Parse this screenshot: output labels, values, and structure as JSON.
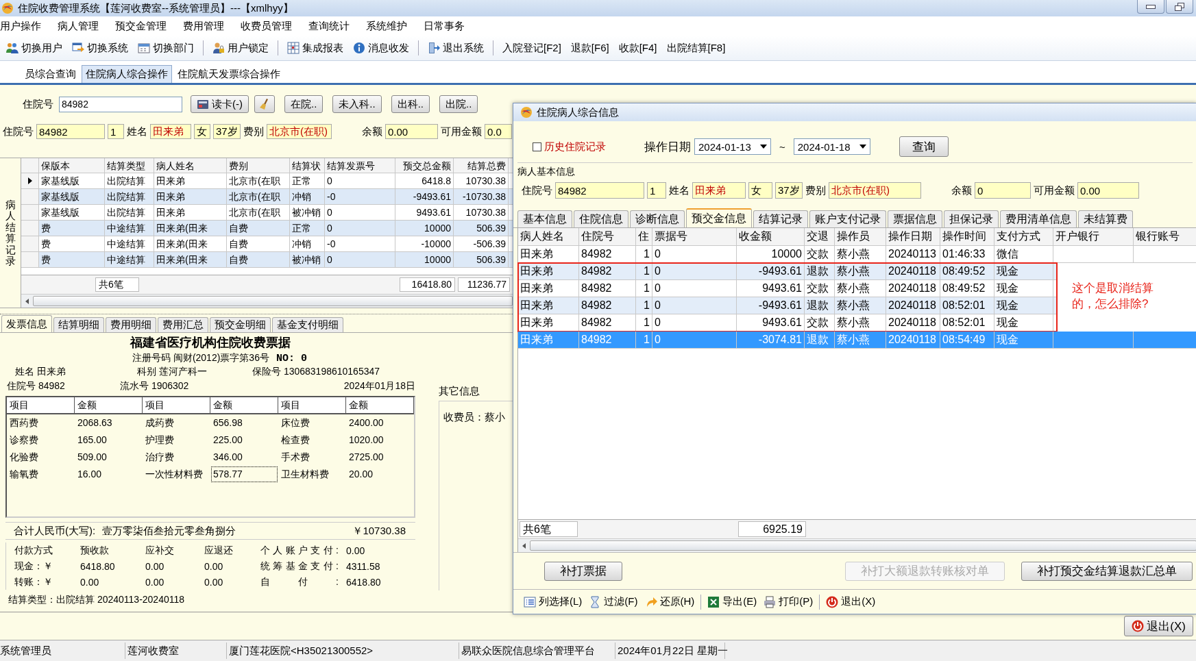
{
  "window": {
    "title": "住院收费管理系统【莲河收费室--系统管理员】---【xmlhyy】"
  },
  "menu": [
    "用户操作",
    "病人管理",
    "预交金管理",
    "费用管理",
    "收费员管理",
    "查询统计",
    "系统维护",
    "日常事务"
  ],
  "toolbar": {
    "groups": [
      [
        {
          "label": "切换用户"
        },
        {
          "label": "切换系统"
        },
        {
          "label": "切换部门"
        }
      ],
      [
        {
          "label": "用户锁定"
        }
      ],
      [
        {
          "label": "集成报表"
        },
        {
          "label": "消息收发"
        }
      ],
      [
        {
          "label": "退出系统"
        }
      ],
      [
        {
          "label": "入院登记[F2]"
        },
        {
          "label": "退款[F6]"
        },
        {
          "label": "收款[F4]"
        },
        {
          "label": "出院结算[F8]"
        }
      ]
    ]
  },
  "top_tabs": [
    {
      "label": "员综合查询",
      "selected": false
    },
    {
      "label": "住院病人综合操作",
      "selected": true
    },
    {
      "label": "住院航天发票综合操作",
      "selected": false
    }
  ],
  "search": {
    "label": "住院号",
    "value": "84982",
    "buttons": [
      {
        "kind": "card",
        "label": "读卡(-)"
      },
      {
        "kind": "broom"
      },
      {
        "kind": "plain",
        "label": "在院.."
      },
      {
        "kind": "plain",
        "label": "未入科.."
      },
      {
        "kind": "plain",
        "label": "出科.."
      },
      {
        "kind": "plain",
        "label": "出院.."
      }
    ]
  },
  "patient_info": {
    "fields": [
      {
        "label": "住院号",
        "value": "84982",
        "alert": false
      },
      {
        "value": "1",
        "alert": false
      },
      {
        "label": "姓名",
        "value": "田来弟",
        "alert": true
      },
      {
        "value": "女",
        "alert": false
      },
      {
        "value": "37岁",
        "alert": false
      },
      {
        "label": "费别",
        "value": "北京市(在职)",
        "alert": true
      },
      {
        "label": "余额",
        "value": "0.00",
        "alert": false
      },
      {
        "label": "可用金额",
        "value": "0.0",
        "alert": false
      }
    ]
  },
  "settlements": {
    "side_label": "病人结算记录",
    "columns": [
      "保版本",
      "结算类型",
      "病人姓名",
      "费别",
      "结算状",
      "结算发票号",
      "预交总金额",
      "结算总费"
    ],
    "rows": [
      {
        "current": true,
        "cells": [
          "家基线版",
          "出院结算",
          "田来弟",
          "北京市(在职",
          "正常",
          "0",
          "6418.8",
          "10730.38"
        ]
      },
      {
        "current": false,
        "cells": [
          "家基线版",
          "出院结算",
          "田来弟",
          "北京市(在职",
          "冲销",
          "-0",
          "-9493.61",
          "-10730.38"
        ]
      },
      {
        "current": false,
        "cells": [
          "家基线版",
          "出院结算",
          "田来弟",
          "北京市(在职",
          "被冲销",
          "0",
          "9493.61",
          "10730.38"
        ]
      },
      {
        "current": false,
        "cells": [
          "费",
          "中途结算",
          "田来弟(田来",
          "自费",
          "正常",
          "0",
          "10000",
          "506.39"
        ]
      },
      {
        "current": false,
        "cells": [
          "费",
          "中途结算",
          "田来弟(田来",
          "自费",
          "冲销",
          "-0",
          "-10000",
          "-506.39"
        ]
      },
      {
        "current": false,
        "cells": [
          "费",
          "中途结算",
          "田来弟(田来",
          "自费",
          "被冲销",
          "0",
          "10000",
          "506.39"
        ]
      }
    ],
    "footer": {
      "count": "共6笔",
      "totals": [
        "16418.80",
        "11236.77"
      ]
    }
  },
  "receipt_tabs": [
    {
      "label": "发票信息",
      "selected": true
    },
    {
      "label": "结算明细",
      "selected": false
    },
    {
      "label": "费用明细",
      "selected": false
    },
    {
      "label": "费用汇总",
      "selected": false
    },
    {
      "label": "预交金明细",
      "selected": false
    },
    {
      "label": "基金支付明细",
      "selected": false
    }
  ],
  "receipt": {
    "title": "福建省医疗机构住院收费票据",
    "registration": "注册号码 闽财(2012)票字第36号",
    "number": "NO: 0",
    "header_lines": [
      [
        "姓名 田来弟",
        "科别 莲河产科一",
        "保险号 130683198610165347"
      ],
      [
        "住院号 84982",
        "流水号 1906302",
        "2024年01月18日"
      ]
    ],
    "fee_headers": [
      "项目",
      "金额",
      "项目",
      "金额",
      "项目",
      "金额"
    ],
    "fees": [
      {
        "item": "西药费",
        "amount": "2068.63",
        "focused": false
      },
      {
        "item": "成药费",
        "amount": "656.98",
        "focused": false
      },
      {
        "item": "床位费",
        "amount": "2400.00",
        "focused": false
      },
      {
        "item": "诊察费",
        "amount": "165.00",
        "focused": false
      },
      {
        "item": "护理费",
        "amount": "225.00",
        "focused": false
      },
      {
        "item": "检查费",
        "amount": "1020.00",
        "focused": false
      },
      {
        "item": "化验费",
        "amount": "509.00",
        "focused": false
      },
      {
        "item": "治疗费",
        "amount": "346.00",
        "focused": false
      },
      {
        "item": "手术费",
        "amount": "2725.00",
        "focused": false
      },
      {
        "item": "输氧费",
        "amount": "16.00",
        "focused": false
      },
      {
        "item": "一次性材料费",
        "amount": "578.77",
        "focused": true
      },
      {
        "item": "卫生材料费",
        "amount": "20.00",
        "focused": false
      }
    ],
    "total_label": "合计人民币(大写):",
    "total_words": "壹万零柒佰叁拾元零叁角捌分",
    "total_amount": "￥10730.38",
    "payment": {
      "headers": [
        "付款方式",
        "预收款",
        "应补交",
        "应退还"
      ],
      "rows": [
        [
          "现金：￥",
          "6418.80",
          "0.00",
          "0.00"
        ],
        [
          "转账：￥",
          "0.00",
          "0.00",
          "0.00"
        ]
      ],
      "fund": [
        {
          "label": "个人账户支付:",
          "value": "0.00"
        },
        {
          "label": "统筹基金支付:",
          "value": "4311.58"
        },
        {
          "label": "自付:",
          "value": "6418.80"
        }
      ]
    },
    "settle_type": "结算类型：出院结算 20240113-20240118"
  },
  "other_info": {
    "title": "其它信息",
    "cashier": "收费员：蔡小"
  },
  "dialog": {
    "title": "住院病人综合信息",
    "history": {
      "label": "历史住院记录",
      "checked": false
    },
    "date_label": "操作日期",
    "date_from": "2024-01-13",
    "range_sep": "~",
    "date_to": "2024-01-18",
    "query_button": "查询",
    "group_title": "病人基本信息",
    "fields": [
      {
        "label": "住院号",
        "value": "84982",
        "alert": false
      },
      {
        "value": "1",
        "alert": false
      },
      {
        "label": "姓名",
        "value": "田来弟",
        "alert": true
      },
      {
        "value": "女",
        "alert": false
      },
      {
        "value": "37岁",
        "alert": false
      },
      {
        "label": "费别",
        "value": "北京市(在职)",
        "alert": true
      },
      {
        "label": "余额",
        "value": "0",
        "alert": false
      },
      {
        "label": "可用金额",
        "value": "0.00",
        "alert": false
      }
    ],
    "tabs": [
      {
        "label": "基本信息",
        "selected": false
      },
      {
        "label": "住院信息",
        "selected": false
      },
      {
        "label": "诊断信息",
        "selected": false
      },
      {
        "label": "预交金信息",
        "selected": true
      },
      {
        "label": "结算记录",
        "selected": false
      },
      {
        "label": "账户支付记录",
        "selected": false
      },
      {
        "label": "票据信息",
        "selected": false
      },
      {
        "label": "担保记录",
        "selected": false
      },
      {
        "label": "费用清单信息",
        "selected": false
      },
      {
        "label": "未结算费",
        "selected": false
      }
    ],
    "table": {
      "columns": [
        "病人姓名",
        "住院号",
        "住",
        "票据号",
        "收金额",
        "交退",
        "操作员",
        "操作日期",
        "操作时间",
        "支付方式",
        "开户银行",
        "银行账号"
      ],
      "rows": [
        {
          "selected": false,
          "flagged": false,
          "cells": [
            "田来弟",
            "84982",
            "1",
            "0",
            "10000",
            "交款",
            "蔡小燕",
            "20240113",
            "01:46:33",
            "微信"
          ]
        },
        {
          "selected": false,
          "flagged": true,
          "cells": [
            "田来弟",
            "84982",
            "1",
            "0",
            "-9493.61",
            "退款",
            "蔡小燕",
            "20240118",
            "08:49:52",
            "现金"
          ]
        },
        {
          "selected": false,
          "flagged": true,
          "cells": [
            "田来弟",
            "84982",
            "1",
            "0",
            "9493.61",
            "交款",
            "蔡小燕",
            "20240118",
            "08:49:52",
            "现金"
          ]
        },
        {
          "selected": false,
          "flagged": true,
          "cells": [
            "田来弟",
            "84982",
            "1",
            "0",
            "-9493.61",
            "退款",
            "蔡小燕",
            "20240118",
            "08:52:01",
            "现金"
          ]
        },
        {
          "selected": false,
          "flagged": true,
          "cells": [
            "田来弟",
            "84982",
            "1",
            "0",
            "9493.61",
            "交款",
            "蔡小燕",
            "20240118",
            "08:52:01",
            "现金"
          ]
        },
        {
          "selected": true,
          "flagged": false,
          "cells": [
            "田来弟",
            "84982",
            "1",
            "0",
            "-3074.81",
            "退款",
            "蔡小燕",
            "20240118",
            "08:54:49",
            "现金"
          ]
        }
      ],
      "annotation": "这个是取消结算的，怎么排除?",
      "footer": {
        "count": "共6笔",
        "total": "6925.19"
      }
    },
    "buttons": [
      {
        "label": "补打票据",
        "disabled": false
      },
      {
        "label": "补打大额退款转账核对单",
        "disabled": true
      },
      {
        "label": "补打预交金结算退款汇总单",
        "disabled": false
      }
    ],
    "toolbar": {
      "groups": [
        [
          {
            "label": "列选择(L)"
          },
          {
            "label": "过滤(F)"
          },
          {
            "label": "还原(H)"
          }
        ],
        [
          {
            "label": "导出(E)"
          },
          {
            "label": "打印(P)"
          }
        ],
        [
          {
            "label": "退出(X)"
          }
        ]
      ]
    }
  },
  "exit_button": {
    "label": "退出(X)"
  },
  "status_bar": [
    "系统管理员",
    "莲河收费室",
    "厦门莲花医院<H35021300552>",
    "易联众医院信息综合管理平台",
    "2024年01月22日 星期一"
  ]
}
